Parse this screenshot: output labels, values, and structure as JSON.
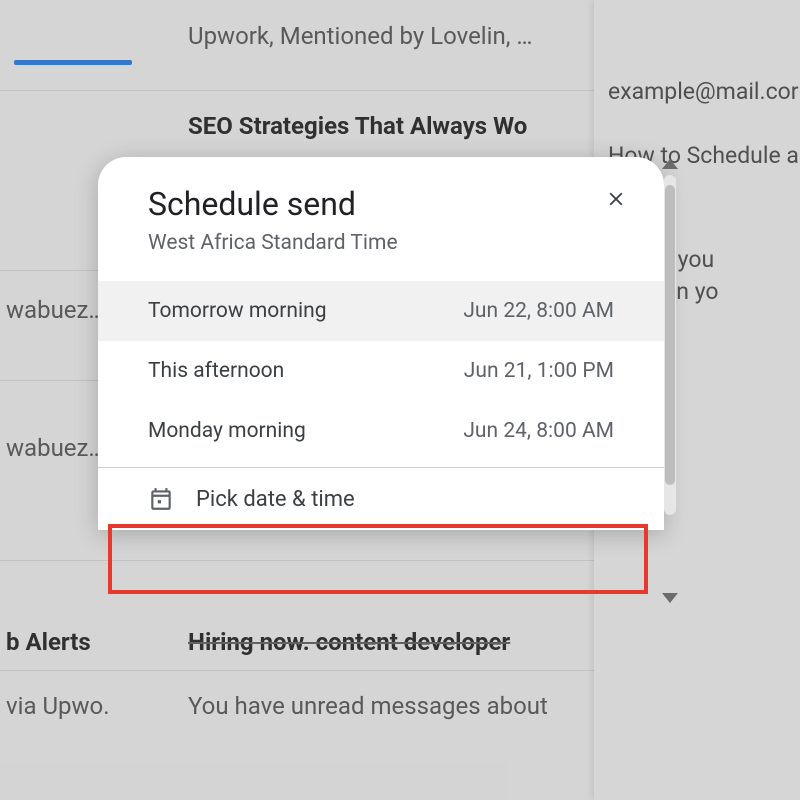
{
  "background": {
    "snippet_top": "Upwork, Mentioned by Lovelin, …",
    "subject": "SEO Strategies That Always Wo",
    "sender_fragment_1": "wabuez…",
    "sender_fragment_2": "wabuez…",
    "alerts_label": "b Alerts",
    "via_label": "via Upwo.",
    "hiring_line": "Hiring now.   content developer",
    "unread_line": "You have unread messages about"
  },
  "side_panel": {
    "email": "example@mail.cor",
    "subject": "How to Schedule a",
    "body_line_1": "meets you",
    "body_line_2": "imail on yo"
  },
  "dialog": {
    "title": "Schedule send",
    "timezone": "West Africa Standard Time",
    "options": [
      {
        "label": "Tomorrow morning",
        "time": "Jun 22, 8:00 AM"
      },
      {
        "label": "This afternoon",
        "time": "Jun 21, 1:00 PM"
      },
      {
        "label": "Monday morning",
        "time": "Jun 24, 8:00 AM"
      }
    ],
    "pick_label": "Pick date & time"
  }
}
